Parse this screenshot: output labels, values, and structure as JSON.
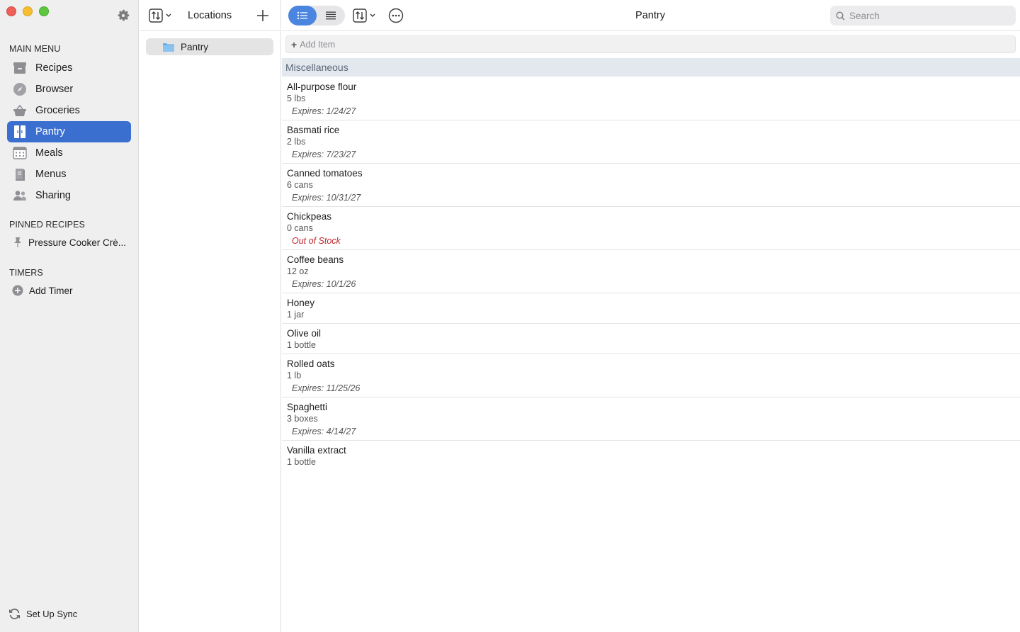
{
  "window": {
    "title": "Pantry"
  },
  "sidebar": {
    "main_menu_title": "MAIN MENU",
    "items": [
      {
        "label": "Recipes",
        "icon": "recipes-box-icon"
      },
      {
        "label": "Browser",
        "icon": "compass-icon"
      },
      {
        "label": "Groceries",
        "icon": "basket-icon"
      },
      {
        "label": "Pantry",
        "icon": "pantry-cabinet-icon",
        "active": true
      },
      {
        "label": "Meals",
        "icon": "calendar-icon"
      },
      {
        "label": "Menus",
        "icon": "menu-book-icon"
      },
      {
        "label": "Sharing",
        "icon": "people-icon"
      }
    ],
    "pinned_title": "PINNED RECIPES",
    "pinned": [
      {
        "label": "Pressure Cooker Crè..."
      }
    ],
    "timers_title": "TIMERS",
    "add_timer_label": "Add Timer",
    "sync_label": "Set Up Sync"
  },
  "locations": {
    "title": "Locations",
    "items": [
      {
        "label": "Pantry",
        "selected": true
      }
    ]
  },
  "main": {
    "title": "Pantry",
    "search_placeholder": "Search",
    "add_item_label": "Add Item",
    "section_title": "Miscellaneous",
    "items": [
      {
        "name": "All-purpose flour",
        "qty": "5 lbs",
        "note": "Expires: 1/24/27",
        "out": false
      },
      {
        "name": "Basmati rice",
        "qty": "2 lbs",
        "note": "Expires: 7/23/27",
        "out": false
      },
      {
        "name": "Canned tomatoes",
        "qty": "6 cans",
        "note": "Expires: 10/31/27",
        "out": false
      },
      {
        "name": "Chickpeas",
        "qty": "0 cans",
        "note": "Out of Stock",
        "out": true
      },
      {
        "name": "Coffee beans",
        "qty": "12 oz",
        "note": "Expires: 10/1/26",
        "out": false
      },
      {
        "name": "Honey",
        "qty": "1 jar",
        "note": "",
        "out": false
      },
      {
        "name": "Olive oil",
        "qty": "1 bottle",
        "note": "",
        "out": false
      },
      {
        "name": "Rolled oats",
        "qty": "1 lb",
        "note": "Expires: 11/25/26",
        "out": false
      },
      {
        "name": "Spaghetti",
        "qty": "3 boxes",
        "note": "Expires: 4/14/27",
        "out": false
      },
      {
        "name": "Vanilla extract",
        "qty": "1 bottle",
        "note": "",
        "out": false
      }
    ]
  },
  "colors": {
    "accent": "#3a6fd0",
    "section_header_bg": "#e3e8ee",
    "out_of_stock": "#c0252a"
  }
}
